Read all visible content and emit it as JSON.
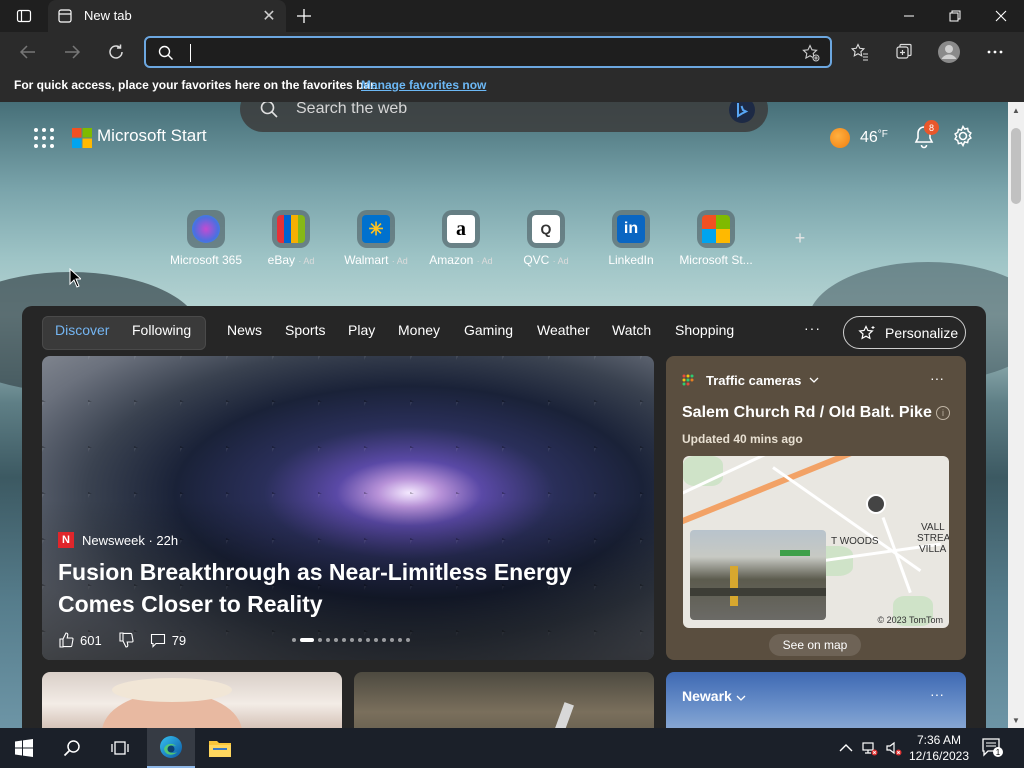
{
  "browser": {
    "tab_title": "New tab",
    "address_value": "",
    "favorites_bar": {
      "text": "For quick access, place your favorites here on the favorites bar.",
      "link": "Manage favorites now"
    }
  },
  "newtab": {
    "search_placeholder": "Search the web",
    "brand": "Microsoft Start",
    "weather": {
      "temp": "46",
      "unit": "°F"
    },
    "notifications_count": "8",
    "quick_links": [
      {
        "name": "Microsoft 365",
        "ad": ""
      },
      {
        "name": "eBay",
        "ad": "· Ad"
      },
      {
        "name": "Walmart",
        "ad": "· Ad"
      },
      {
        "name": "Amazon",
        "ad": "· Ad"
      },
      {
        "name": "QVC",
        "ad": "· Ad"
      },
      {
        "name": "LinkedIn",
        "ad": ""
      },
      {
        "name": "Microsoft St...",
        "ad": ""
      }
    ],
    "add_link": "+"
  },
  "feed": {
    "tabs": [
      "Discover",
      "Following",
      "News",
      "Sports",
      "Play",
      "Money",
      "Gaming",
      "Weather",
      "Watch",
      "Shopping"
    ],
    "more": "···",
    "personalize": "Personalize",
    "hero": {
      "source": "Newsweek · 22h",
      "source_initial": "N",
      "headline": "Fusion Breakthrough as Near-Limitless Energy Comes Closer to Reality",
      "likes": "601",
      "comments": "79"
    },
    "traffic": {
      "header": "Traffic cameras",
      "location": "Salem Church Rd / Old Balt. Pike",
      "updated": "Updated 40 mins ago",
      "map_labels": [
        "T WOODS",
        "VALL",
        "STREA",
        "VILLA"
      ],
      "copyright": "© 2023 TomTom",
      "see_on_map": "See on map"
    },
    "newark": {
      "title": "Newark"
    }
  },
  "taskbar": {
    "time": "7:36 AM",
    "date": "12/16/2023",
    "notification_count": "1"
  },
  "colors": {
    "accent_blue": "#74b5f2",
    "badge_orange": "#e8572b"
  }
}
